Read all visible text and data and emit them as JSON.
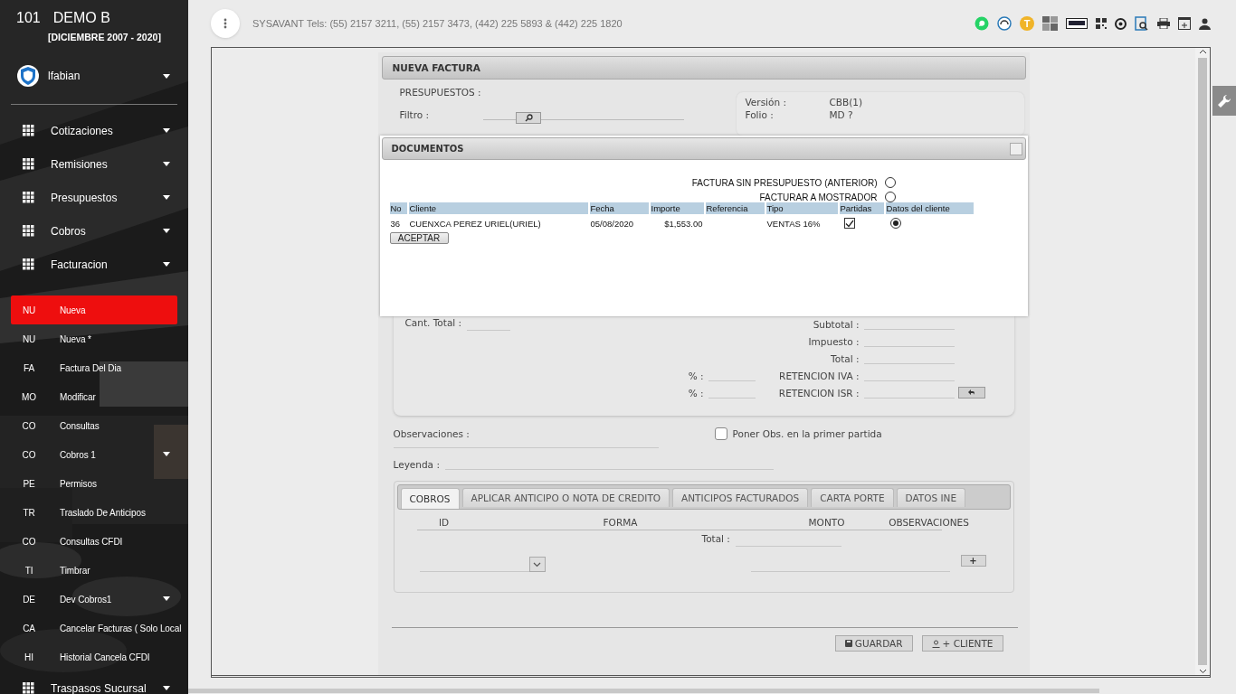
{
  "header": {
    "company_number": "101",
    "company_name": "DEMO B",
    "period": "[DICIEMBRE 2007 - 2020]"
  },
  "user": {
    "name": "lfabian"
  },
  "menu": [
    {
      "kind": "group",
      "label": "Cotizaciones",
      "submenu": true,
      "selected": false
    },
    {
      "kind": "group",
      "label": "Remisiones",
      "submenu": true,
      "selected": false
    },
    {
      "kind": "group",
      "label": "Presupuestos",
      "submenu": true,
      "selected": false
    },
    {
      "kind": "group",
      "label": "Cobros",
      "submenu": true,
      "selected": false
    },
    {
      "kind": "group",
      "label": "Facturacion",
      "submenu": true,
      "selected": false,
      "children": [
        {
          "kind": "item",
          "abbr": "NU",
          "label": "Nueva",
          "submenu": false,
          "selected": true
        },
        {
          "kind": "item",
          "abbr": "NU",
          "label": "Nueva *",
          "submenu": false,
          "selected": false
        },
        {
          "kind": "item",
          "abbr": "FA",
          "label": "Factura Del Dia",
          "submenu": false,
          "selected": false
        },
        {
          "kind": "item",
          "abbr": "MO",
          "label": "Modificar",
          "submenu": false,
          "selected": false
        },
        {
          "kind": "item",
          "abbr": "CO",
          "label": "Consultas",
          "submenu": false,
          "selected": false
        },
        {
          "kind": "item",
          "abbr": "CO",
          "label": "Cobros 1",
          "submenu": true,
          "selected": false
        },
        {
          "kind": "item",
          "abbr": "PE",
          "label": "Permisos",
          "submenu": false,
          "selected": false
        },
        {
          "kind": "item",
          "abbr": "TR",
          "label": "Traslado De Anticipos",
          "submenu": false,
          "selected": false
        },
        {
          "kind": "item",
          "abbr": "CO",
          "label": "Consultas CFDI",
          "submenu": false,
          "selected": false
        },
        {
          "kind": "item",
          "abbr": "TI",
          "label": "Timbrar",
          "submenu": false,
          "selected": false
        },
        {
          "kind": "item",
          "abbr": "DE",
          "label": "Dev Cobros1",
          "submenu": true,
          "selected": false
        },
        {
          "kind": "item",
          "abbr": "CA",
          "label": "Cancelar Facturas ( Solo Local",
          "submenu": false,
          "selected": false
        },
        {
          "kind": "item",
          "abbr": "HI",
          "label": "Historial Cancela CFDI",
          "submenu": false,
          "selected": false
        }
      ]
    },
    {
      "kind": "group",
      "label": "Traspasos Sucursal",
      "submenu": true,
      "selected": false
    }
  ],
  "topbar": {
    "contact": "SYSAVANT Tels: (55) 2157 3211, (55) 2157 3473, (442) 225 5893 & (442) 225 1820",
    "badge_letter": "T"
  },
  "form": {
    "title": "NUEVA FACTURA",
    "presupuestos_label": "PRESUPUESTOS :",
    "filter_label": "Filtro :",
    "info": [
      {
        "label": "Versión :",
        "value": "CBB(1)"
      },
      {
        "label": "Folio :",
        "value": "MD ?"
      }
    ],
    "cant_total_label": "Cant. Total :",
    "totals": [
      "Subtotal :",
      "Impuesto :",
      "Total :"
    ],
    "retenciones": [
      {
        "pct_label": "% :",
        "label": "RETENCION IVA :"
      },
      {
        "pct_label": "% :",
        "label": "RETENCION ISR :"
      }
    ],
    "observaciones_label": "Observaciones :",
    "obs_checkbox": {
      "label": "Poner Obs. en la primer partida",
      "checked": false
    },
    "leyenda_label": "Leyenda :",
    "tabs": [
      {
        "label": "COBROS",
        "selected": true
      },
      {
        "label": "APLICAR ANTICIPO O NOTA DE CREDITO",
        "selected": false
      },
      {
        "label": "ANTICIPOS FACTURADOS",
        "selected": false
      },
      {
        "label": "CARTA PORTE",
        "selected": false
      },
      {
        "label": "DATOS INE",
        "selected": false
      }
    ],
    "cobros_columns": [
      "ID",
      "FORMA",
      "MONTO",
      "OBSERVACIONES"
    ],
    "cobros_total_label": "Total :",
    "add_button": "+",
    "buttons": [
      {
        "kind": "save",
        "label": "GUARDAR"
      },
      {
        "kind": "client",
        "label": "+ CLIENTE"
      }
    ]
  },
  "documents": {
    "title": "DOCUMENTOS",
    "options": [
      {
        "label": "FACTURA SIN PRESUPUESTO (ANTERIOR)",
        "selected": false
      },
      {
        "label": "FACTURAR A MOSTRADOR",
        "selected": false
      }
    ],
    "columns": [
      "No",
      "Cliente",
      "Fecha",
      "Importe",
      "Referencia",
      "Tipo",
      "Partidas",
      "Datos del cliente"
    ],
    "rows": [
      {
        "no": "36",
        "cliente": "CUENXCA PEREZ URIEL(URIEL)",
        "fecha": "05/08/2020",
        "importe": "$1,553.00",
        "tipo": "VENTAS 16%",
        "partidas": true,
        "datos_cliente": true
      }
    ],
    "accept_button": "ACEPTAR"
  }
}
